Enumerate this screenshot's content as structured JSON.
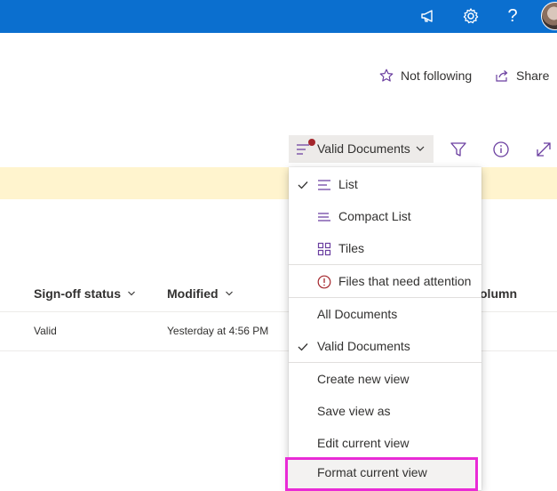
{
  "topbar": {
    "color": "#0b6fcf",
    "icons": [
      "megaphone-icon",
      "gear-icon",
      "help-icon",
      "avatar"
    ],
    "help_glyph": "?"
  },
  "commands": {
    "follow_label": "Not following",
    "share_label": "Share"
  },
  "view_selector": {
    "label": "Valid Documents",
    "has_alert_dot": true
  },
  "toolbar_icons": [
    "filter-icon",
    "info-icon",
    "expand-icon"
  ],
  "columns": {
    "signoff": "Sign-off status",
    "modified": "Modified",
    "partial": "olumn"
  },
  "rows": [
    {
      "signoff": "Valid",
      "modified": "Yesterday at 4:56 PM"
    }
  ],
  "menu": {
    "layout_items": [
      {
        "label": "List",
        "checked": true
      },
      {
        "label": "Compact List",
        "checked": false
      },
      {
        "label": "Tiles",
        "checked": false
      }
    ],
    "attention_item": "Files that need attention",
    "view_items": [
      {
        "label": "All Documents",
        "checked": false
      },
      {
        "label": "Valid Documents",
        "checked": true
      }
    ],
    "action_items": [
      "Create new view",
      "Save view as",
      "Edit current view",
      "Format current view"
    ],
    "highlight_color": "#e92bd6"
  }
}
